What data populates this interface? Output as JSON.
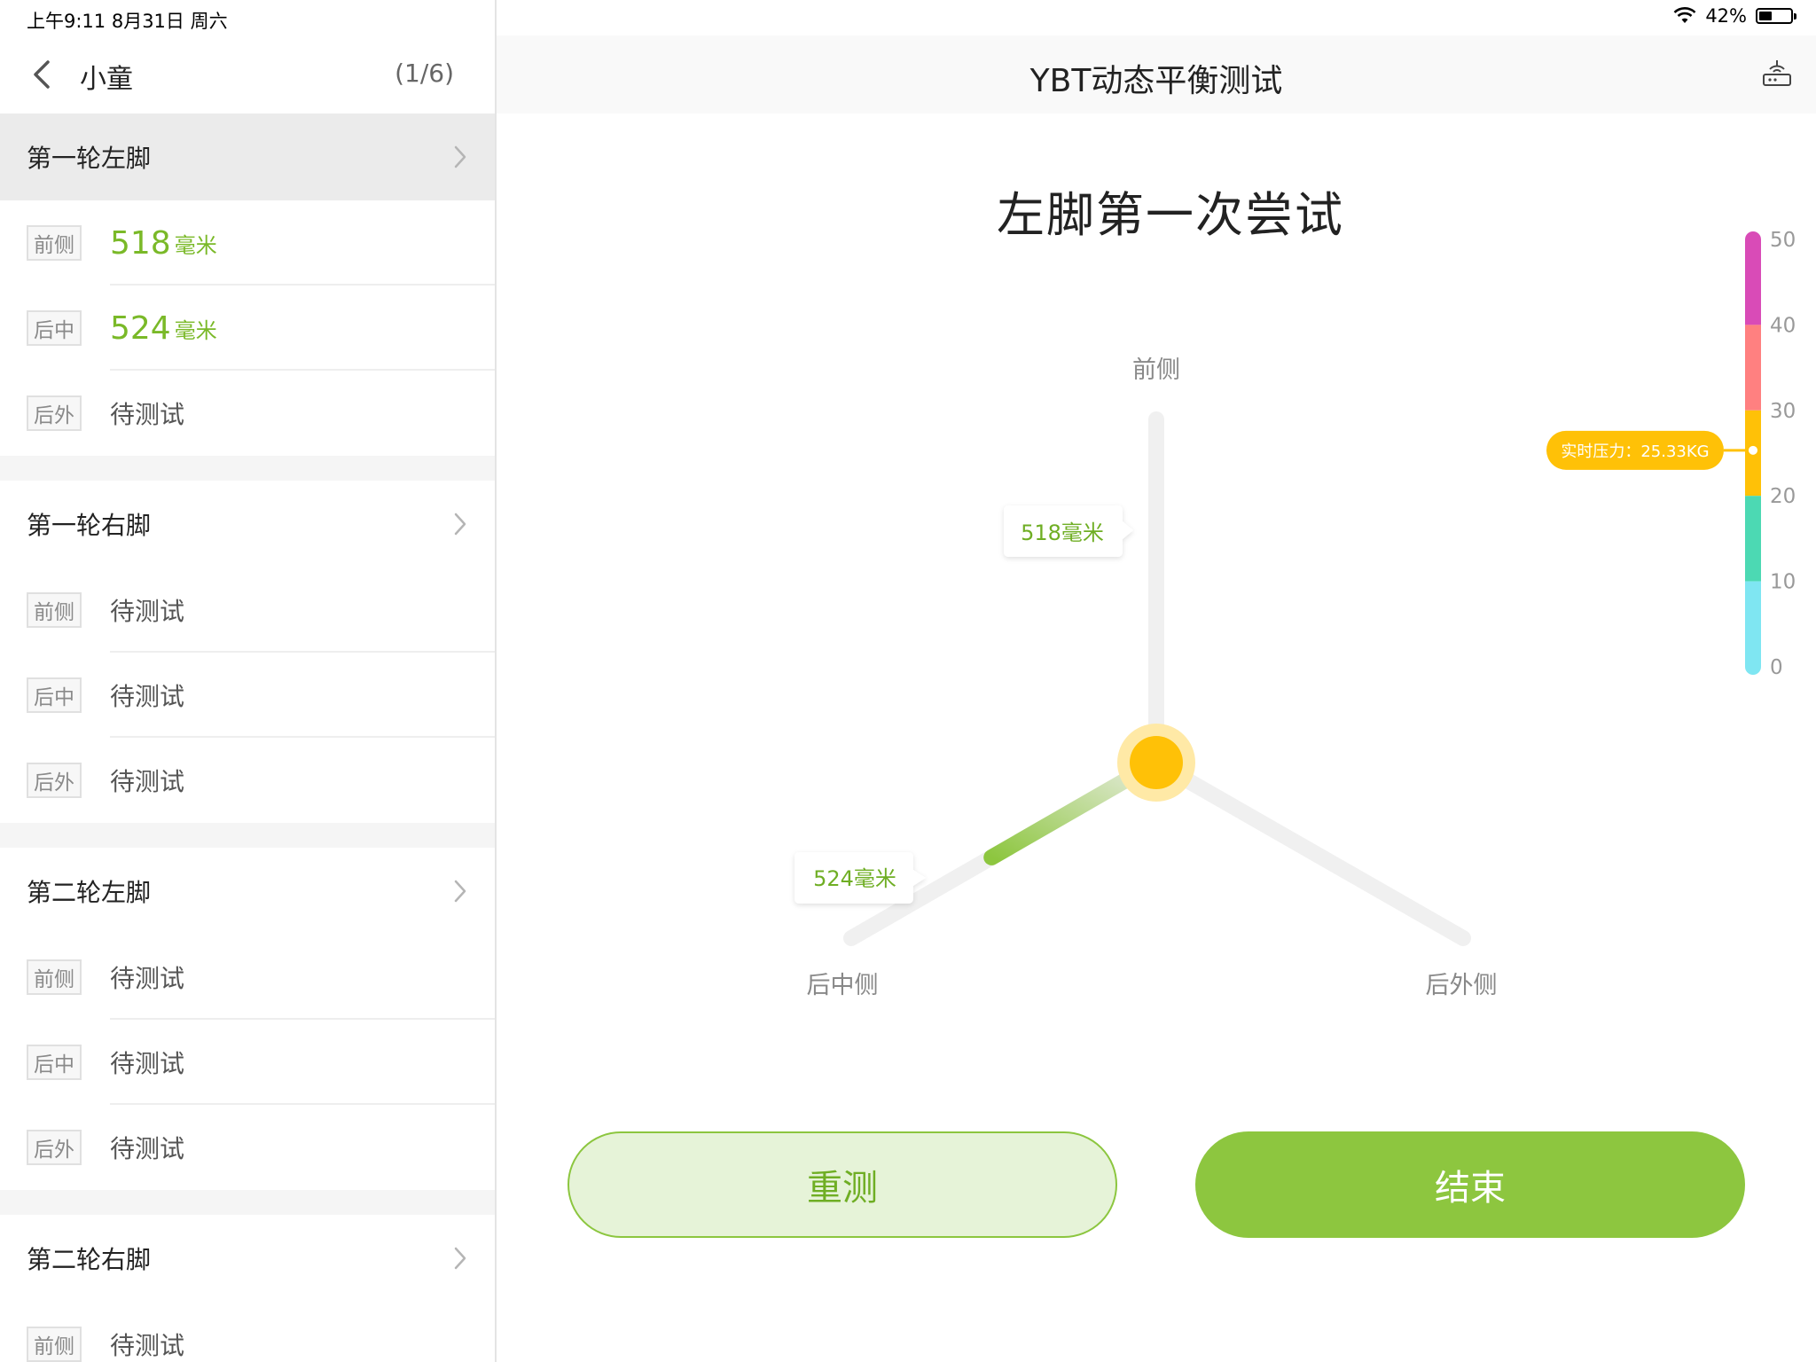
{
  "status_bar": {
    "time": "上午9:11  8月31日 周六",
    "battery": "42%",
    "battery_level": 0.42
  },
  "sidebar": {
    "student_name": "小童",
    "page_count": "(1/6)",
    "rounds": [
      {
        "title": "第一轮左脚",
        "active": true,
        "items": [
          {
            "label": "前侧",
            "value": "518",
            "unit": "毫米",
            "done": true
          },
          {
            "label": "后中",
            "value": "524",
            "unit": "毫米",
            "done": true
          },
          {
            "label": "后外",
            "value": "待测试",
            "unit": "",
            "done": false
          }
        ]
      },
      {
        "title": "第一轮右脚",
        "active": false,
        "items": [
          {
            "label": "前侧",
            "value": "待测试",
            "unit": "",
            "done": false
          },
          {
            "label": "后中",
            "value": "待测试",
            "unit": "",
            "done": false
          },
          {
            "label": "后外",
            "value": "待测试",
            "unit": "",
            "done": false
          }
        ]
      },
      {
        "title": "第二轮左脚",
        "active": false,
        "items": [
          {
            "label": "前侧",
            "value": "待测试",
            "unit": "",
            "done": false
          },
          {
            "label": "后中",
            "value": "待测试",
            "unit": "",
            "done": false
          },
          {
            "label": "后外",
            "value": "待测试",
            "unit": "",
            "done": false
          }
        ]
      },
      {
        "title": "第二轮右脚",
        "active": false,
        "items": [
          {
            "label": "前侧",
            "value": "待测试",
            "unit": "",
            "done": false
          }
        ]
      }
    ]
  },
  "header": {
    "title": "YBT动态平衡测试",
    "device_icon": "device-connect-icon"
  },
  "test": {
    "attempt_title": "左脚第一次尝试",
    "directions": {
      "anterior": "前侧",
      "posteromedial": "后中侧",
      "posterolateral": "后外侧"
    },
    "anterior_label": "518毫米",
    "posteromedial_label": "524毫米",
    "anterior_fraction": 0.73,
    "posteromedial_fraction": 0.54,
    "posterolateral_fraction": 0
  },
  "pressure_gauge": {
    "ticks": [
      "50",
      "40",
      "30",
      "20",
      "10",
      "0"
    ],
    "min": 0,
    "max": 50,
    "current_value": 25.33,
    "label": "实时压力：25.33KG",
    "bands": [
      {
        "from": 40,
        "to": 50,
        "color": "#d94bb7"
      },
      {
        "from": 30,
        "to": 40,
        "color": "#ff8080"
      },
      {
        "from": 20,
        "to": 30,
        "color": "#ffc107"
      },
      {
        "from": 10,
        "to": 20,
        "color": "#4cd9b3"
      },
      {
        "from": 0,
        "to": 10,
        "color": "#7fe6f2"
      }
    ]
  },
  "buttons": {
    "retest": "重测",
    "end": "结束"
  },
  "colors": {
    "accent": "#8dc63f",
    "center": "#ffc107",
    "track": "#f0f0f0"
  }
}
